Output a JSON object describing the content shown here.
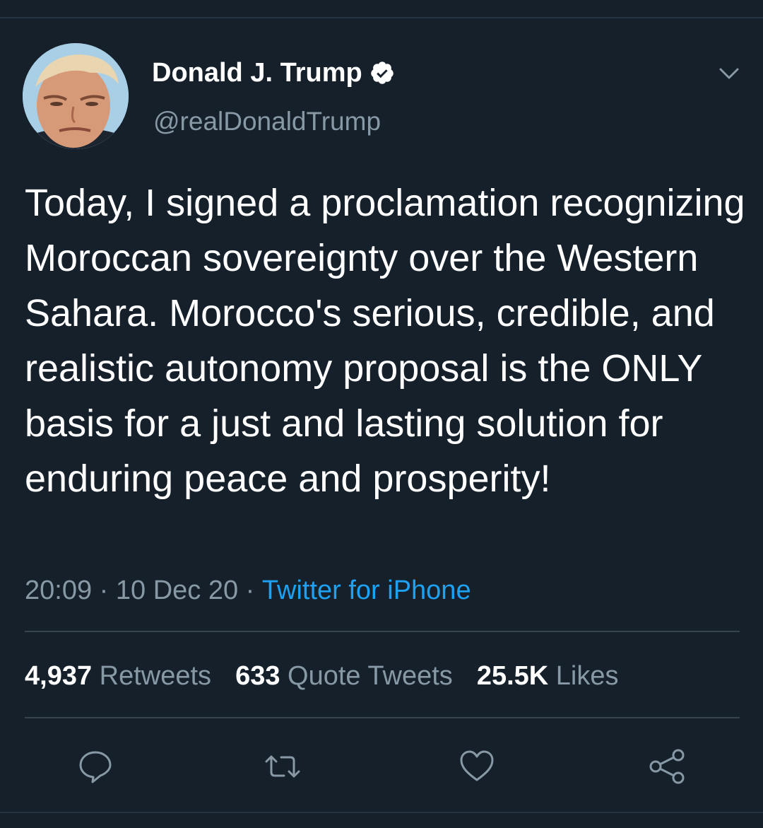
{
  "tweet": {
    "author": {
      "display_name": "Donald J. Trump",
      "handle": "@realDonaldTrump",
      "verified": true
    },
    "text": "Today, I signed a proclamation recognizing Moroccan sovereignty over the Western Sahara.  Morocco's serious, credible, and realistic autonomy proposal is the ONLY basis for a just and lasting solution for enduring peace and prosperity!",
    "time": "20:09",
    "date": "10 Dec 20",
    "separator": " · ",
    "source": "Twitter for iPhone",
    "stats": {
      "retweets_count": "4,937",
      "retweets_label": "Retweets",
      "quotes_count": "633",
      "quotes_label": "Quote Tweets",
      "likes_count": "25.5K",
      "likes_label": "Likes"
    },
    "actions": [
      "reply-icon",
      "retweet-icon",
      "like-icon",
      "share-icon"
    ]
  },
  "colors": {
    "background": "#15202b",
    "text": "#ffffff",
    "secondary_text": "#8899a6",
    "link": "#1da1f2",
    "divider": "#38444d"
  }
}
